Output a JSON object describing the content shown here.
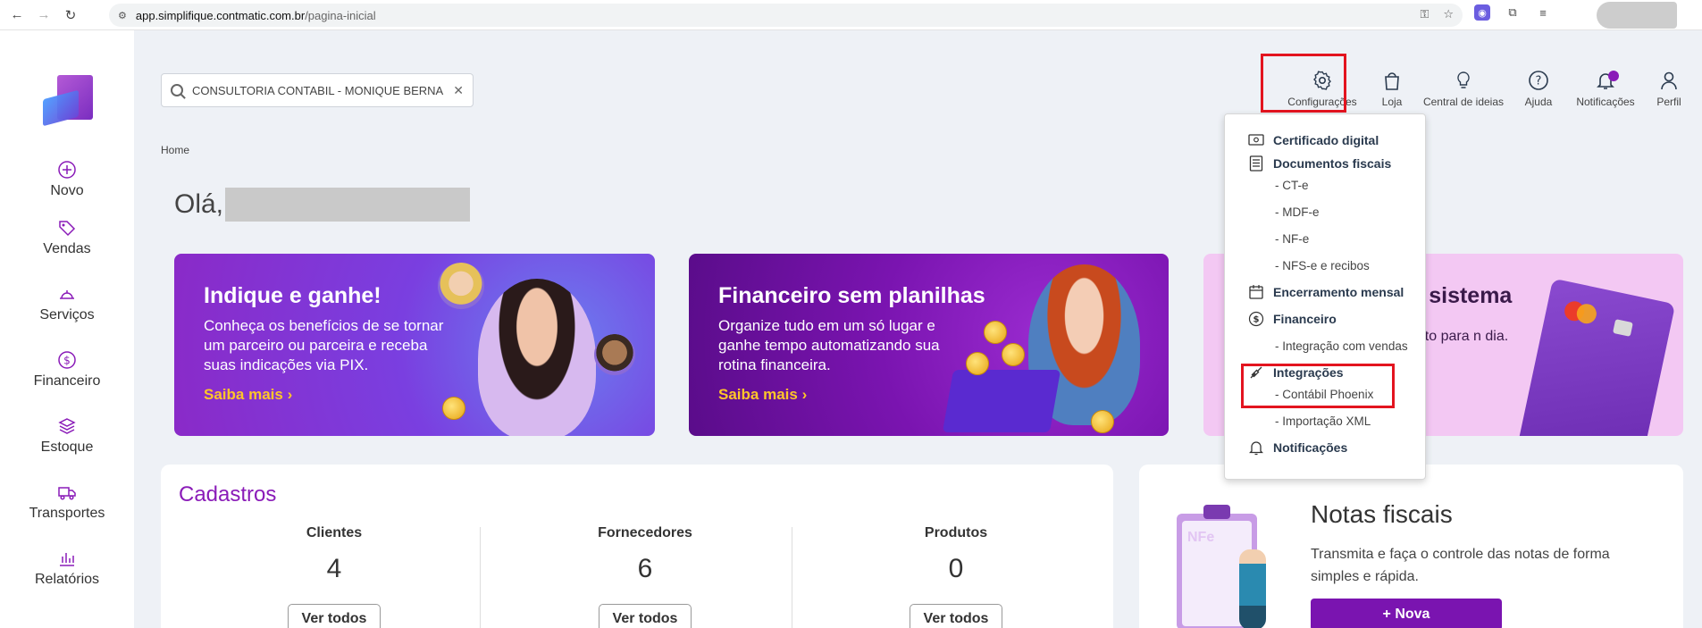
{
  "browser": {
    "url_host": "app.simplifique.contmatic.com.br",
    "url_path": "/pagina-inicial"
  },
  "sidebar": {
    "items": [
      {
        "label": "Novo",
        "icon": "plus-circle-icon"
      },
      {
        "label": "Vendas",
        "icon": "tag-icon"
      },
      {
        "label": "Serviços",
        "icon": "service-bell-icon"
      },
      {
        "label": "Financeiro",
        "icon": "dollar-circle-icon"
      },
      {
        "label": "Estoque",
        "icon": "boxes-icon"
      },
      {
        "label": "Transportes",
        "icon": "truck-icon"
      },
      {
        "label": "Relatórios",
        "icon": "bar-chart-icon"
      }
    ]
  },
  "header": {
    "company": "CONSULTORIA CONTABIL - MONIQUE BERNARDES",
    "top_nav": [
      {
        "label": "Configurações",
        "icon": "gear-icon"
      },
      {
        "label": "Loja",
        "icon": "shopping-bag-icon"
      },
      {
        "label": "Central de ideias",
        "icon": "lightbulb-icon"
      },
      {
        "label": "Ajuda",
        "icon": "help-icon"
      },
      {
        "label": "Notificações",
        "icon": "bell-icon"
      },
      {
        "label": "Perfil",
        "icon": "user-icon"
      }
    ]
  },
  "breadcrumb": "Home",
  "greeting": "Olá,",
  "banners": [
    {
      "title": "Indique e ganhe!",
      "text": "Conheça os benefícios de se tornar um parceiro ou parceira e receba suas indicações via PIX.",
      "link": "Saiba mais"
    },
    {
      "title": "Financeiro sem planilhas",
      "text": "Organize tudo em um só lugar e ganhe tempo automatizando sua rotina financeira.",
      "link": "Saiba mais"
    },
    {
      "title": "o sistema",
      "text": "ento para n dia."
    }
  ],
  "cadastros": {
    "title": "Cadastros",
    "columns": [
      {
        "label": "Clientes",
        "value": "4",
        "button": "Ver todos"
      },
      {
        "label": "Fornecedores",
        "value": "6",
        "button": "Ver todos"
      },
      {
        "label": "Produtos",
        "value": "0",
        "button": "Ver todos"
      }
    ]
  },
  "notas": {
    "title": "Notas fiscais",
    "text": "Transmita e faça o controle das notas de forma simples e rápida.",
    "button": "+ Nova",
    "illus_label": "NFe"
  },
  "config_menu": {
    "items": [
      {
        "label": "Certificado digital",
        "icon": "certificate-icon"
      },
      {
        "label": "Documentos fiscais",
        "icon": "document-list-icon"
      },
      {
        "label": "- CT-e"
      },
      {
        "label": "- MDF-e"
      },
      {
        "label": "- NF-e"
      },
      {
        "label": "- NFS-e e recibos"
      },
      {
        "label": "Encerramento mensal",
        "icon": "calendar-icon"
      },
      {
        "label": "Financeiro",
        "icon": "dollar-circle-icon"
      },
      {
        "label": "- Integração com vendas"
      },
      {
        "label": "Integrações",
        "icon": "plug-icon"
      },
      {
        "label": "- Contábil Phoenix"
      },
      {
        "label": "- Importação XML"
      },
      {
        "label": "Notificações",
        "icon": "bell-icon"
      }
    ]
  },
  "colors": {
    "brand_purple": "#8a1bb8",
    "highlight_red": "#e3141f",
    "link_yellow": "#ffc629"
  }
}
